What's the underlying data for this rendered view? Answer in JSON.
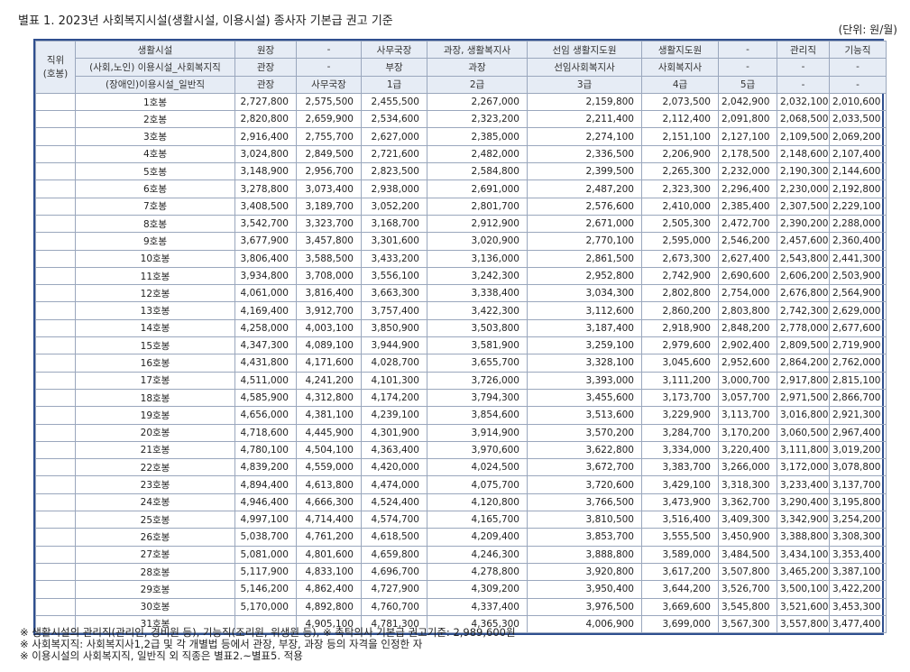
{
  "title": "별표 1. 2023년 사회복지시설(생활시설, 이용시설) 종사자 기본급 권고 기준",
  "unit": "(단위: 원/월)",
  "header": {
    "left": [
      "직위",
      "(호봉)"
    ],
    "row1_label": "생활시설",
    "row2_label": "(사회,노인) 이용시설_사회복지직",
    "row3_label": "(장애인)이용시설_일반직",
    "row1": [
      "원장",
      "-",
      "사무국장",
      "과장, 생활복지사",
      "선임 생활지도원",
      "생활지도원",
      "-",
      "관리직",
      "기능직"
    ],
    "row2": [
      "관장",
      "-",
      "부장",
      "과장",
      "선임사회복지사",
      "사회복지사",
      "-",
      "-",
      "-"
    ],
    "row3": [
      "관장",
      "사무국장",
      "1급",
      "2급",
      "3급",
      "4급",
      "5급",
      "-",
      "-"
    ]
  },
  "rows": [
    {
      "step": "1호봉",
      "v": [
        "2,727,800",
        "2,575,500",
        "2,455,500",
        "2,267,000",
        "2,159,800",
        "2,073,500",
        "2,042,900",
        "2,032,100",
        "2,010,600"
      ]
    },
    {
      "step": "2호봉",
      "v": [
        "2,820,800",
        "2,659,900",
        "2,534,600",
        "2,323,200",
        "2,211,400",
        "2,112,400",
        "2,091,800",
        "2,068,500",
        "2,033,500"
      ]
    },
    {
      "step": "3호봉",
      "v": [
        "2,916,400",
        "2,755,700",
        "2,627,000",
        "2,385,000",
        "2,274,100",
        "2,151,100",
        "2,127,100",
        "2,109,500",
        "2,069,200"
      ]
    },
    {
      "step": "4호봉",
      "v": [
        "3,024,800",
        "2,849,500",
        "2,721,600",
        "2,482,000",
        "2,336,500",
        "2,206,900",
        "2,178,500",
        "2,148,600",
        "2,107,400"
      ]
    },
    {
      "step": "5호봉",
      "v": [
        "3,148,900",
        "2,956,700",
        "2,823,500",
        "2,584,800",
        "2,399,500",
        "2,265,300",
        "2,232,000",
        "2,190,300",
        "2,144,600"
      ]
    },
    {
      "step": "6호봉",
      "v": [
        "3,278,800",
        "3,073,400",
        "2,938,000",
        "2,691,000",
        "2,487,200",
        "2,323,300",
        "2,296,400",
        "2,230,000",
        "2,192,800"
      ]
    },
    {
      "step": "7호봉",
      "v": [
        "3,408,500",
        "3,189,700",
        "3,052,200",
        "2,801,700",
        "2,576,600",
        "2,410,000",
        "2,385,400",
        "2,307,500",
        "2,229,100"
      ]
    },
    {
      "step": "8호봉",
      "v": [
        "3,542,700",
        "3,323,700",
        "3,168,700",
        "2,912,900",
        "2,671,000",
        "2,505,300",
        "2,472,700",
        "2,390,200",
        "2,288,000"
      ]
    },
    {
      "step": "9호봉",
      "v": [
        "3,677,900",
        "3,457,800",
        "3,301,600",
        "3,020,900",
        "2,770,100",
        "2,595,000",
        "2,546,200",
        "2,457,600",
        "2,360,400"
      ]
    },
    {
      "step": "10호봉",
      "v": [
        "3,806,400",
        "3,588,500",
        "3,433,200",
        "3,136,000",
        "2,861,500",
        "2,673,300",
        "2,627,400",
        "2,543,800",
        "2,441,300"
      ]
    },
    {
      "step": "11호봉",
      "v": [
        "3,934,800",
        "3,708,000",
        "3,556,100",
        "3,242,300",
        "2,952,800",
        "2,742,900",
        "2,690,600",
        "2,606,200",
        "2,503,900"
      ]
    },
    {
      "step": "12호봉",
      "v": [
        "4,061,000",
        "3,816,400",
        "3,663,300",
        "3,338,400",
        "3,034,300",
        "2,802,800",
        "2,754,000",
        "2,676,800",
        "2,564,900"
      ]
    },
    {
      "step": "13호봉",
      "v": [
        "4,169,400",
        "3,912,700",
        "3,757,400",
        "3,422,300",
        "3,112,600",
        "2,860,200",
        "2,803,800",
        "2,742,300",
        "2,629,000"
      ]
    },
    {
      "step": "14호봉",
      "v": [
        "4,258,000",
        "4,003,100",
        "3,850,900",
        "3,503,800",
        "3,187,400",
        "2,918,900",
        "2,848,200",
        "2,778,000",
        "2,677,600"
      ]
    },
    {
      "step": "15호봉",
      "v": [
        "4,347,300",
        "4,089,100",
        "3,944,900",
        "3,581,900",
        "3,259,100",
        "2,979,600",
        "2,902,400",
        "2,809,500",
        "2,719,900"
      ]
    },
    {
      "step": "16호봉",
      "v": [
        "4,431,800",
        "4,171,600",
        "4,028,700",
        "3,655,700",
        "3,328,100",
        "3,045,600",
        "2,952,600",
        "2,864,200",
        "2,762,000"
      ]
    },
    {
      "step": "17호봉",
      "v": [
        "4,511,000",
        "4,241,200",
        "4,101,300",
        "3,726,000",
        "3,393,000",
        "3,111,200",
        "3,000,700",
        "2,917,800",
        "2,815,100"
      ]
    },
    {
      "step": "18호봉",
      "v": [
        "4,585,900",
        "4,312,800",
        "4,174,200",
        "3,794,300",
        "3,455,600",
        "3,173,700",
        "3,057,700",
        "2,971,500",
        "2,866,700"
      ]
    },
    {
      "step": "19호봉",
      "v": [
        "4,656,000",
        "4,381,100",
        "4,239,100",
        "3,854,600",
        "3,513,600",
        "3,229,900",
        "3,113,700",
        "3,016,800",
        "2,921,300"
      ]
    },
    {
      "step": "20호봉",
      "v": [
        "4,718,600",
        "4,445,900",
        "4,301,900",
        "3,914,900",
        "3,570,200",
        "3,284,700",
        "3,170,200",
        "3,060,500",
        "2,967,400"
      ]
    },
    {
      "step": "21호봉",
      "v": [
        "4,780,100",
        "4,504,100",
        "4,363,400",
        "3,970,600",
        "3,622,800",
        "3,334,000",
        "3,220,400",
        "3,111,800",
        "3,019,200"
      ]
    },
    {
      "step": "22호봉",
      "v": [
        "4,839,200",
        "4,559,000",
        "4,420,000",
        "4,024,500",
        "3,672,700",
        "3,383,700",
        "3,266,000",
        "3,172,000",
        "3,078,800"
      ]
    },
    {
      "step": "23호봉",
      "v": [
        "4,894,400",
        "4,613,800",
        "4,474,000",
        "4,075,700",
        "3,720,600",
        "3,429,100",
        "3,318,300",
        "3,233,400",
        "3,137,700"
      ]
    },
    {
      "step": "24호봉",
      "v": [
        "4,946,400",
        "4,666,300",
        "4,524,400",
        "4,120,800",
        "3,766,500",
        "3,473,900",
        "3,362,700",
        "3,290,400",
        "3,195,800"
      ]
    },
    {
      "step": "25호봉",
      "v": [
        "4,997,100",
        "4,714,400",
        "4,574,700",
        "4,165,700",
        "3,810,500",
        "3,516,400",
        "3,409,300",
        "3,342,900",
        "3,254,200"
      ]
    },
    {
      "step": "26호봉",
      "v": [
        "5,038,700",
        "4,761,200",
        "4,618,500",
        "4,209,400",
        "3,853,700",
        "3,555,500",
        "3,450,900",
        "3,388,800",
        "3,308,300"
      ]
    },
    {
      "step": "27호봉",
      "v": [
        "5,081,000",
        "4,801,600",
        "4,659,800",
        "4,246,300",
        "3,888,800",
        "3,589,000",
        "3,484,500",
        "3,434,100",
        "3,353,400"
      ]
    },
    {
      "step": "28호봉",
      "v": [
        "5,117,900",
        "4,833,100",
        "4,696,700",
        "4,278,800",
        "3,920,800",
        "3,617,200",
        "3,507,800",
        "3,465,200",
        "3,387,100"
      ]
    },
    {
      "step": "29호봉",
      "v": [
        "5,146,200",
        "4,862,400",
        "4,727,900",
        "4,309,200",
        "3,950,400",
        "3,644,200",
        "3,526,700",
        "3,500,100",
        "3,422,200"
      ]
    },
    {
      "step": "30호봉",
      "v": [
        "5,170,000",
        "4,892,800",
        "4,760,700",
        "4,337,400",
        "3,976,500",
        "3,669,600",
        "3,545,800",
        "3,521,600",
        "3,453,300"
      ]
    },
    {
      "step": "31호봉",
      "v": [
        "",
        "4,905,100",
        "4,781,300",
        "4,365,300",
        "4,006,900",
        "3,699,000",
        "3,567,300",
        "3,557,800",
        "3,477,400"
      ]
    }
  ],
  "notes": [
    "※ 생활시설의 관리직(관리인, 경비원 등), 기능직(조리원, 위생원 등), ※ 촉탁의사 기본급 권고기준: 2,989,600원",
    "※ 사회복지직: 사회복지사1,2급 및 각 개별법 등에서 관장, 부장, 과장 등의 자격을 인정한 자",
    "※ 이용시설의 사회복지직, 일반직 외 직종은 별표2.~별표5. 적용"
  ]
}
